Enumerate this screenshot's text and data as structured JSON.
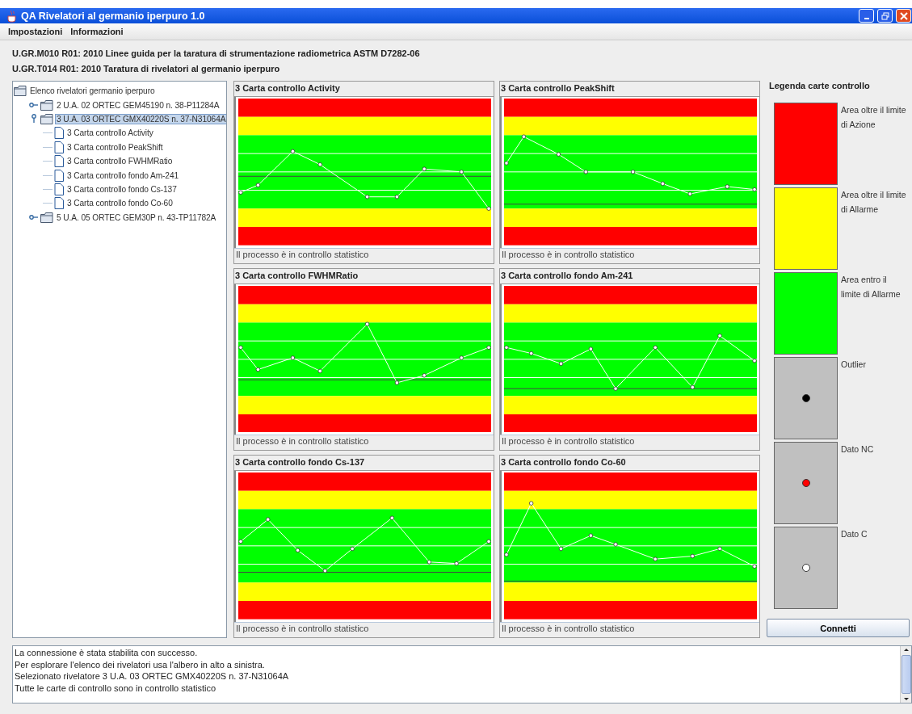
{
  "window": {
    "title": "QA Rivelatori al germanio iperpuro 1.0"
  },
  "menu": [
    "Impostazioni",
    "Informazioni"
  ],
  "header_lines": [
    "U.GR.M010 R01: 2010 Linee guida per la taratura di strumentazione radiometrica ASTM D7282-06",
    "U.GR.T014 R01: 2010 Taratura di rivelatori al germanio iperpuro"
  ],
  "tree": {
    "label": "Elenco rivelatori germanio iperpuro",
    "kind": "folder",
    "selected": false,
    "children": [
      {
        "label": "2 U.A. 02 ORTEC GEM45190 n. 38-P11284A",
        "kind": "folder",
        "expanded": false,
        "selected": false
      },
      {
        "label": "3 U.A. 03 ORTEC GMX40220S n. 37-N31064A",
        "kind": "folder",
        "expanded": true,
        "selected": true,
        "children": [
          {
            "label": "3 Carta controllo Activity",
            "kind": "file",
            "selected": false
          },
          {
            "label": "3 Carta controllo PeakShift",
            "kind": "file",
            "selected": false
          },
          {
            "label": "3 Carta controllo FWHMRatio",
            "kind": "file",
            "selected": false
          },
          {
            "label": "3 Carta controllo fondo Am-241",
            "kind": "file",
            "selected": false
          },
          {
            "label": "3 Carta controllo fondo Cs-137",
            "kind": "file",
            "selected": false
          },
          {
            "label": "3 Carta controllo fondo Co-60",
            "kind": "file",
            "selected": false
          }
        ]
      },
      {
        "label": "5 U.A. 05 ORTEC GEM30P n. 43-TP11782A",
        "kind": "folder",
        "expanded": false,
        "selected": false
      }
    ]
  },
  "charts": [
    {
      "title": "3 Carta controllo Activity",
      "status": "Il processo è in controllo statistico"
    },
    {
      "title": "3 Carta controllo PeakShift",
      "status": "Il processo è in controllo statistico"
    },
    {
      "title": "3 Carta controllo FWHMRatio",
      "status": "Il processo è in controllo statistico"
    },
    {
      "title": "3 Carta controllo fondo Am-241",
      "status": "Il processo è in controllo statistico"
    },
    {
      "title": "3 Carta controllo fondo Cs-137",
      "status": "Il processo è in controllo statistico"
    },
    {
      "title": "3 Carta controllo fondo Co-60",
      "status": "Il processo è in controllo statistico"
    }
  ],
  "legend": {
    "title": "Legenda carte controllo",
    "items": [
      {
        "kind": "area",
        "color": "#ff0000",
        "label": "Area oltre il limite di Azione"
      },
      {
        "kind": "area",
        "color": "#ffff00",
        "label": "Area oltre il limite di Allarme"
      },
      {
        "kind": "area",
        "color": "#00ff00",
        "label": "Area entro il limite di Allarme"
      },
      {
        "kind": "point",
        "color": "#000000",
        "label": "Outlier"
      },
      {
        "kind": "point",
        "color": "#ff0000",
        "label": "Dato NC"
      },
      {
        "kind": "point",
        "color": "#ffffff",
        "label": "Dato C"
      }
    ]
  },
  "connect_button": "Connetti",
  "log": [
    "La connessione è stata stabilita con successo.",
    "Per esplorare l'elenco dei rivelatori usa l'albero in alto a sinistra.",
    "Selezionato rivelatore 3 U.A. 03 ORTEC GMX40220S n. 37-N31064A",
    "Tutte le carte di controllo sono in controllo statistico"
  ]
}
